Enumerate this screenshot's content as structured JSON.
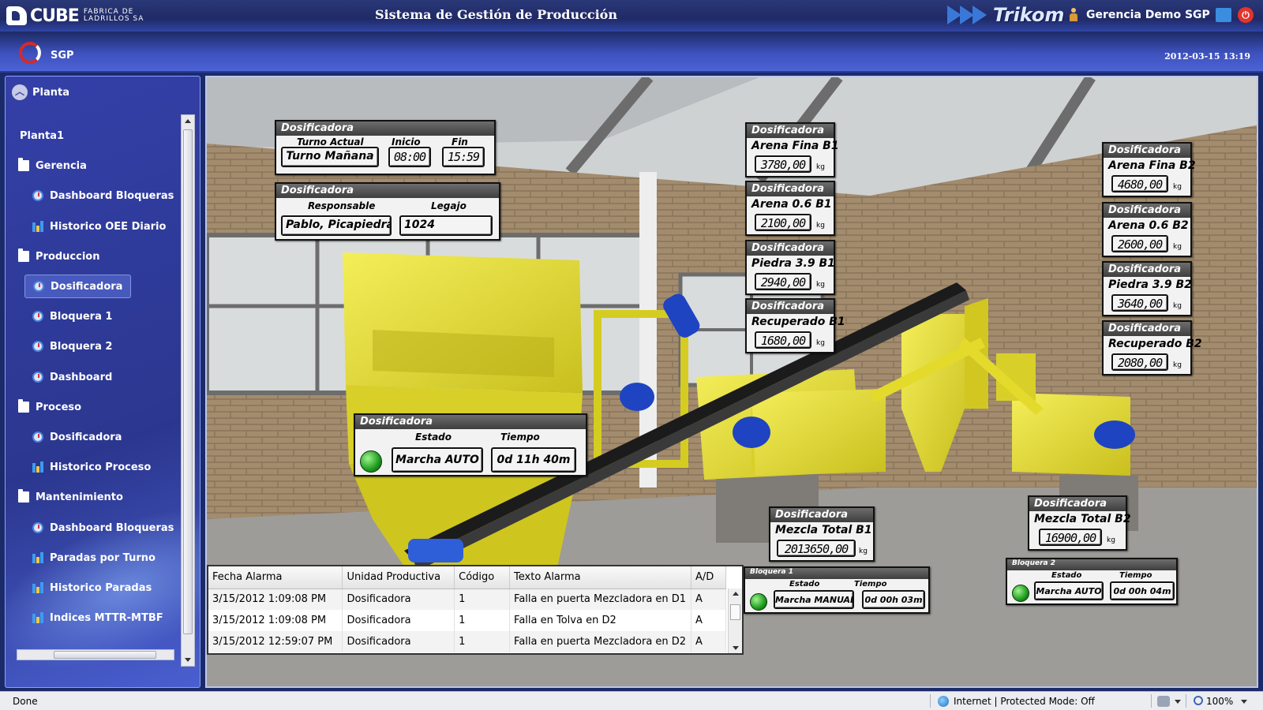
{
  "header": {
    "logo_word": "CUBE",
    "logo_sub": "FABRICA DE LADRILLOS SA",
    "title": "Sistema de Gestión de Producción",
    "partner_logo": "Trikom",
    "user": "Gerencia Demo SGP"
  },
  "subheader": {
    "app": "SGP",
    "datetime": "2012-03-15 13:19"
  },
  "sidebar": {
    "title": "Planta",
    "items": [
      {
        "label": "Planta1",
        "icon": "",
        "level": 0,
        "selected": false
      },
      {
        "label": "Gerencia",
        "icon": "folder-icon",
        "level": 0,
        "selected": false
      },
      {
        "label": "Dashboard Bloqueras",
        "icon": "gauge-icon",
        "level": 1,
        "selected": false
      },
      {
        "label": "Historico OEE Diario",
        "icon": "chart-icon",
        "level": 1,
        "selected": false
      },
      {
        "label": "Produccion",
        "icon": "folder-icon",
        "level": 0,
        "selected": false
      },
      {
        "label": "Dosificadora",
        "icon": "gauge-icon",
        "level": 1,
        "selected": true
      },
      {
        "label": "Bloquera 1",
        "icon": "gauge-icon",
        "level": 1,
        "selected": false
      },
      {
        "label": "Bloquera 2",
        "icon": "gauge-icon",
        "level": 1,
        "selected": false
      },
      {
        "label": "Dashboard",
        "icon": "gauge-icon",
        "level": 1,
        "selected": false
      },
      {
        "label": "Proceso",
        "icon": "folder-icon",
        "level": 0,
        "selected": false
      },
      {
        "label": "Dosificadora",
        "icon": "gauge-icon",
        "level": 1,
        "selected": false
      },
      {
        "label": "Historico Proceso",
        "icon": "chart-icon",
        "level": 1,
        "selected": false
      },
      {
        "label": "Mantenimiento",
        "icon": "folder-icon",
        "level": 0,
        "selected": false
      },
      {
        "label": "Dashboard Bloqueras",
        "icon": "gauge-icon",
        "level": 1,
        "selected": false
      },
      {
        "label": "Paradas por Turno",
        "icon": "chart-icon",
        "level": 1,
        "selected": false
      },
      {
        "label": "Historico Paradas",
        "icon": "chart-icon",
        "level": 1,
        "selected": false
      },
      {
        "label": "Indices MTTR-MTBF",
        "icon": "chart-icon",
        "level": 1,
        "selected": false
      }
    ]
  },
  "shift_panel": {
    "title": "Dosificadora",
    "turno_label": "Turno Actual",
    "turno": "Turno Mañana",
    "inicio_label": "Inicio",
    "inicio": "08:00",
    "fin_label": "Fin",
    "fin": "15:59"
  },
  "responsable_panel": {
    "title": "Dosificadora",
    "responsable_label": "Responsable",
    "responsable": "Pablo, Picapiedras",
    "legajo_label": "Legajo",
    "legajo": "1024"
  },
  "estado_panel": {
    "title": "Dosificadora",
    "estado_label": "Estado",
    "estado": "Marcha AUTO",
    "tiempo_label": "Tiempo",
    "tiempo": "0d 11h 40m"
  },
  "unit": "kg",
  "materials_b1": [
    {
      "title": "Dosificadora",
      "name": "Arena Fina B1",
      "value": "3780,00"
    },
    {
      "title": "Dosificadora",
      "name": "Arena 0.6 B1",
      "value": "2100,00"
    },
    {
      "title": "Dosificadora",
      "name": "Piedra 3.9 B1",
      "value": "2940,00"
    },
    {
      "title": "Dosificadora",
      "name": "Recuperado B1",
      "value": "1680,00"
    }
  ],
  "materials_b2": [
    {
      "title": "Dosificadora",
      "name": "Arena Fina B2",
      "value": "4680,00"
    },
    {
      "title": "Dosificadora",
      "name": "Arena 0.6 B2",
      "value": "2600,00"
    },
    {
      "title": "Dosificadora",
      "name": "Piedra 3.9 B2",
      "value": "3640,00"
    },
    {
      "title": "Dosificadora",
      "name": "Recuperado B2",
      "value": "2080,00"
    }
  ],
  "mezcla_b1": {
    "title": "Dosificadora",
    "name": "Mezcla Total B1",
    "value": "2013650,00"
  },
  "mezcla_b2": {
    "title": "Dosificadora",
    "name": "Mezcla Total B2",
    "value": "16900,00"
  },
  "bloquera1": {
    "title": "Bloquera 1",
    "estado_label": "Estado",
    "estado": "Marcha MANUAL",
    "tiempo_label": "Tiempo",
    "tiempo": "0d 00h 03m"
  },
  "bloquera2": {
    "title": "Bloquera 2",
    "estado_label": "Estado",
    "estado": "Marcha AUTO",
    "tiempo_label": "Tiempo",
    "tiempo": "0d 00h 04m"
  },
  "alarms": {
    "columns": [
      "Fecha Alarma",
      "Unidad Productiva",
      "Código",
      "Texto Alarma",
      "A/D"
    ],
    "rows": [
      [
        "3/15/2012 1:09:08 PM",
        "Dosificadora",
        "1",
        "Falla en puerta Mezcladora en D1",
        "A"
      ],
      [
        "3/15/2012 1:09:08 PM",
        "Dosificadora",
        "1",
        "Falla en Tolva en D2",
        "A"
      ],
      [
        "3/15/2012 12:59:07 PM",
        "Dosificadora",
        "1",
        "Falla en puerta Mezcladora en D2",
        "A"
      ]
    ]
  },
  "statusbar": {
    "status": "Done",
    "zone": "Internet | Protected Mode: Off",
    "zoom": "100%"
  },
  "colors": {
    "header": "#1f2a66",
    "sidebar": "#2b378f",
    "machine_yellow": "#e8e03a",
    "led_green": "#1e9a1e"
  }
}
